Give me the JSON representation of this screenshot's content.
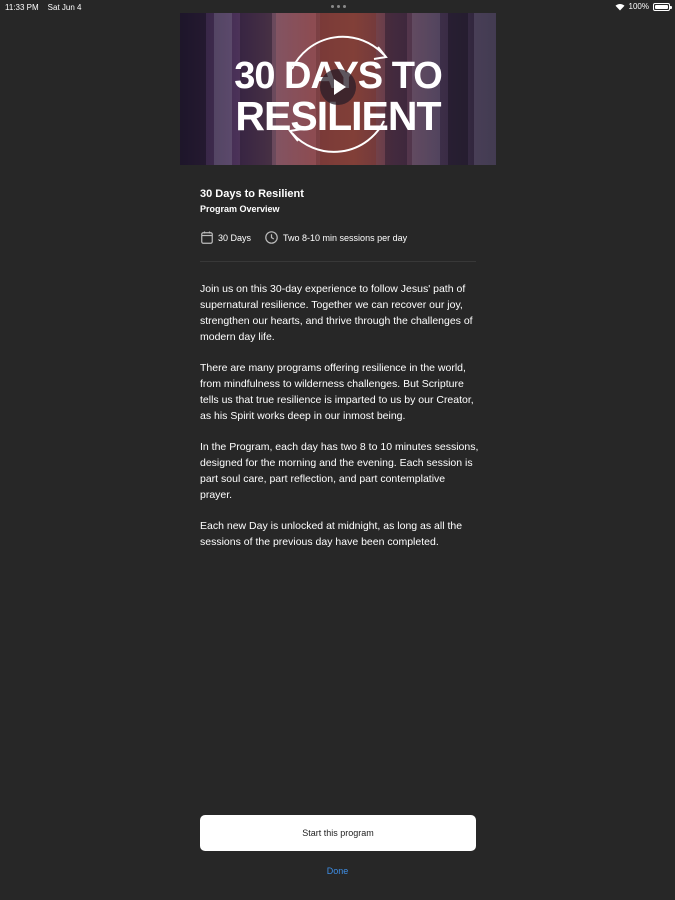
{
  "status_bar": {
    "time": "11:33 PM",
    "date": "Sat Jun 4",
    "battery": "100%"
  },
  "hero": {
    "line1": "30 DAYS TO",
    "line2": "RESILIENT",
    "icon": "play-icon"
  },
  "program": {
    "title": "30 Days to Resilient",
    "subtitle": "Program Overview"
  },
  "meta": {
    "duration": "30 Days",
    "sessions": "Two 8-10 min sessions per day"
  },
  "description": [
    "Join us on this 30-day experience to follow Jesus' path of supernatural resilience. Together we can recover our joy, strengthen our hearts, and thrive through the challenges of modern day life.",
    "There are many programs offering resilience in the world, from mindfulness to wilderness challenges. But Scripture tells us that true resilience is imparted to us by our Creator, as his Spirit works deep in our inmost being.",
    "In the Program, each day has two 8 to 10 minutes sessions, designed for the morning and the evening. Each session is part soul care, part reflection, and part contemplative prayer.",
    "Each new Day is unlocked at midnight, as long as all the sessions of the previous day have been completed."
  ],
  "actions": {
    "start_label": "Start this program",
    "done_label": "Done"
  },
  "colors": {
    "background": "#272727",
    "accent": "#3e8ee5",
    "button_bg": "#ffffff"
  }
}
